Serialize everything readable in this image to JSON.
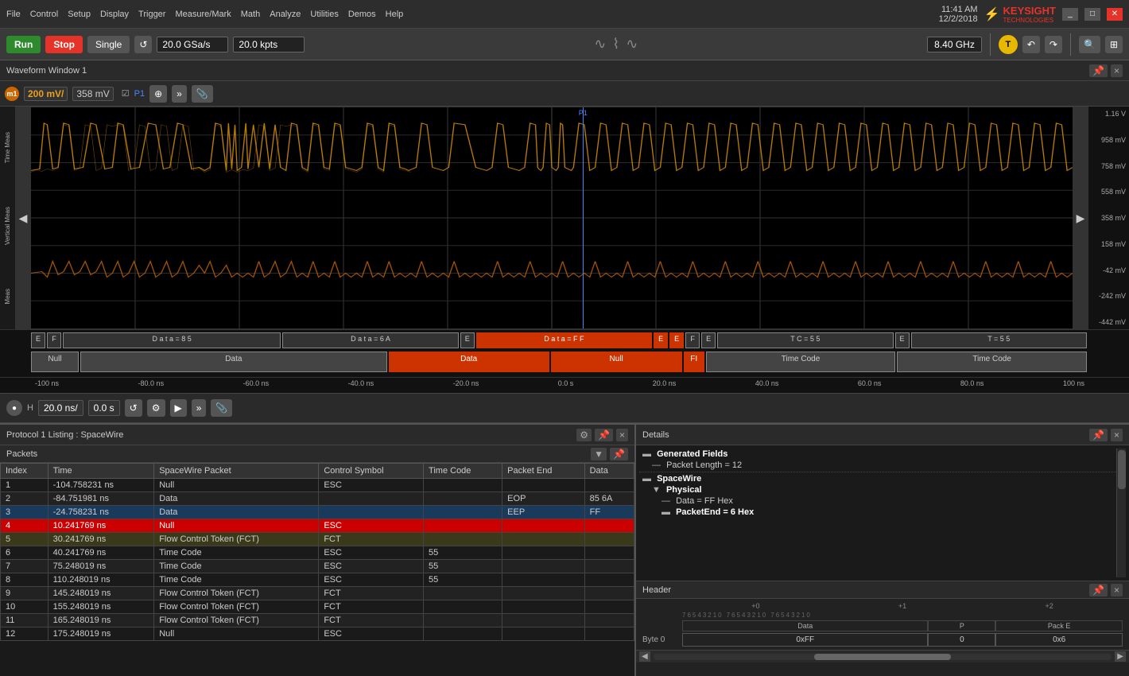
{
  "titlebar": {
    "menus": [
      "File",
      "Control",
      "Setup",
      "Display",
      "Trigger",
      "Measure/Mark",
      "Math",
      "Analyze",
      "Utilities",
      "Demos",
      "Help"
    ],
    "time": "11:41 AM",
    "date": "12/2/2018",
    "logo": "KEYSIGHT",
    "logo_sub": "TECHNOLOGIES"
  },
  "toolbar": {
    "run_label": "Run",
    "stop_label": "Stop",
    "single_label": "Single",
    "sample_rate": "20.0 GSa/s",
    "memory": "20.0 kpts",
    "frequency": "8.40 GHz"
  },
  "waveform": {
    "title": "Waveform Window 1",
    "channel": "m1",
    "scale": "200 mV/",
    "offset": "358 mV",
    "voltage_labels": [
      "1.16 V",
      "958 mV",
      "758 mV",
      "558 mV",
      "358 mV",
      "158 mV",
      "-42 mV",
      "-242 mV",
      "-442 mV"
    ],
    "time_labels": [
      "-100 ns",
      "-80.0 ns",
      "-60.0 ns",
      "-40.0 ns",
      "-20.0 ns",
      "0.0 s",
      "20.0 ns",
      "40.0 ns",
      "60.0 ns",
      "80.0 ns",
      "100 ns"
    ],
    "h_scale": "20.0 ns/",
    "h_offset": "0.0 s",
    "decode_segments": [
      {
        "label": "Null",
        "color": "#444",
        "x": 0,
        "w": 8
      },
      {
        "label": "Data",
        "color": "#444",
        "x": 8,
        "w": 22
      },
      {
        "label": "Data",
        "color": "#cc3300",
        "x": 30,
        "w": 12
      },
      {
        "label": "Null",
        "color": "#cc3300",
        "x": 42,
        "w": 10
      },
      {
        "label": "FI",
        "color": "#cc3300",
        "x": 52,
        "w": 4
      },
      {
        "label": "Time Code",
        "color": "#444",
        "x": 56,
        "w": 18
      },
      {
        "label": "Time Code",
        "color": "#444",
        "x": 74,
        "w": 18
      }
    ],
    "side_labels": [
      "Time Meas",
      "Vertical Meas",
      "Meas"
    ]
  },
  "protocol": {
    "title": "Protocol 1 Listing : SpaceWire",
    "packets_title": "Packets",
    "columns": [
      "Index",
      "Time",
      "SpaceWire Packet",
      "Control Symbol",
      "Time Code",
      "Packet End",
      "Data"
    ],
    "rows": [
      {
        "index": "1",
        "time": "-104.758231 ns",
        "packet": "Null",
        "control": "ESC",
        "timecode": "",
        "packetend": "",
        "data": "",
        "style": "normal"
      },
      {
        "index": "2",
        "time": "-84.751981 ns",
        "packet": "Data",
        "control": "",
        "timecode": "",
        "packetend": "EOP",
        "data": "85 6A",
        "style": "alt"
      },
      {
        "index": "3",
        "time": "-24.758231 ns",
        "packet": "Data",
        "control": "",
        "timecode": "",
        "packetend": "EEP",
        "data": "FF",
        "style": "blue"
      },
      {
        "index": "4",
        "time": "10.241769 ns",
        "packet": "Null",
        "control": "ESC",
        "timecode": "",
        "packetend": "",
        "data": "",
        "style": "selected"
      },
      {
        "index": "5",
        "time": "30.241769 ns",
        "packet": "Flow Control Token (FCT)",
        "control": "FCT",
        "timecode": "",
        "packetend": "",
        "data": "",
        "style": "yellow"
      },
      {
        "index": "6",
        "time": "40.241769 ns",
        "packet": "Time Code",
        "control": "ESC",
        "timecode": "55",
        "packetend": "",
        "data": "",
        "style": "normal"
      },
      {
        "index": "7",
        "time": "75.248019 ns",
        "packet": "Time Code",
        "control": "ESC",
        "timecode": "55",
        "packetend": "",
        "data": "",
        "style": "alt"
      },
      {
        "index": "8",
        "time": "110.248019 ns",
        "packet": "Time Code",
        "control": "ESC",
        "timecode": "55",
        "packetend": "",
        "data": "",
        "style": "normal"
      },
      {
        "index": "9",
        "time": "145.248019 ns",
        "packet": "Flow Control Token (FCT)",
        "control": "FCT",
        "timecode": "",
        "packetend": "",
        "data": "",
        "style": "alt"
      },
      {
        "index": "10",
        "time": "155.248019 ns",
        "packet": "Flow Control Token (FCT)",
        "control": "FCT",
        "timecode": "",
        "packetend": "",
        "data": "",
        "style": "normal"
      },
      {
        "index": "11",
        "time": "165.248019 ns",
        "packet": "Flow Control Token (FCT)",
        "control": "FCT",
        "timecode": "",
        "packetend": "",
        "data": "",
        "style": "alt"
      },
      {
        "index": "12",
        "time": "175.248019 ns",
        "packet": "Null",
        "control": "ESC",
        "timecode": "",
        "packetend": "",
        "data": "",
        "style": "normal"
      }
    ]
  },
  "details": {
    "title": "Details",
    "generated_fields_label": "Generated Fields",
    "packet_length_label": "Packet Length = 12",
    "spacewire_label": "SpaceWire",
    "physical_label": "Physical",
    "data_value": "Data = FF Hex",
    "packet_end_value": "PacketEnd = 6 Hex"
  },
  "header": {
    "title": "Header",
    "bit_labels_plus0": "+0",
    "bit_labels_plus1": "+1",
    "bit_labels_plus2": "+2",
    "byte0_label": "Byte 0",
    "data_col": "Data",
    "p_col": "P",
    "pack_e_col": "Pack E",
    "data_val": "0xFF",
    "p_val": "0",
    "pack_e_val": "0x6"
  }
}
